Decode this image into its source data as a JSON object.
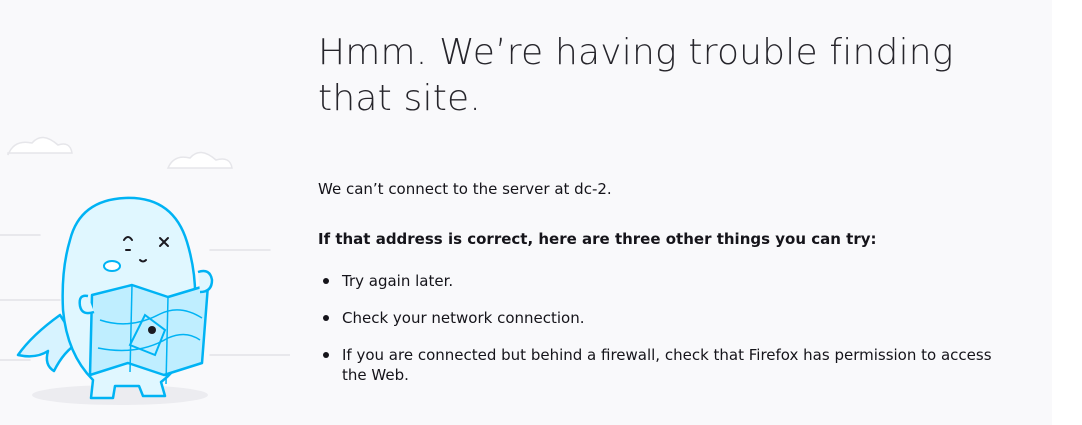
{
  "error_page": {
    "title": "Hmm. We’re having trouble finding that site.",
    "description": "We can’t connect to the server at dc-2.",
    "suggestions_heading": "If that address is correct, here are three other things you can try:",
    "suggestions": [
      "Try again later.",
      "Check your network connection.",
      "If you are connected but behind a firewall, check that Firefox has permission to access the Web."
    ],
    "illustration": "confused-mascot-with-map"
  },
  "colors": {
    "page_background": "#f9f9fb",
    "text": "#15141a",
    "illustration_stroke": "#00b3f4",
    "illustration_fill": "#e0f7ff"
  }
}
